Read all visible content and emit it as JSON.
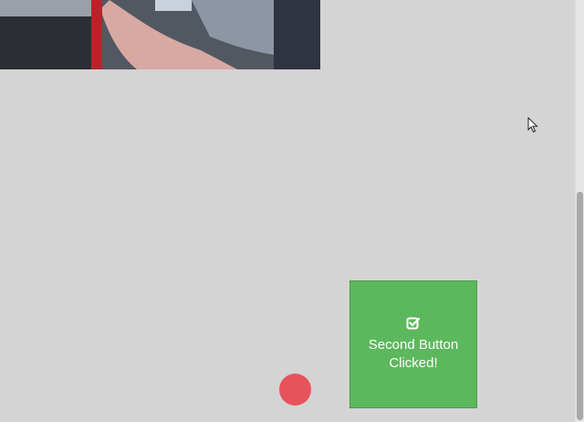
{
  "webcam": {
    "description_icon": "webcam-feed-image"
  },
  "action_button": {
    "label": "Second Button\nClicked!",
    "icon": "check-square-icon",
    "color": "#5cb85c"
  },
  "indicator": {
    "color": "#e8525d"
  },
  "colors": {
    "background": "#d4d4d4",
    "text_on_button": "#ffffff"
  }
}
